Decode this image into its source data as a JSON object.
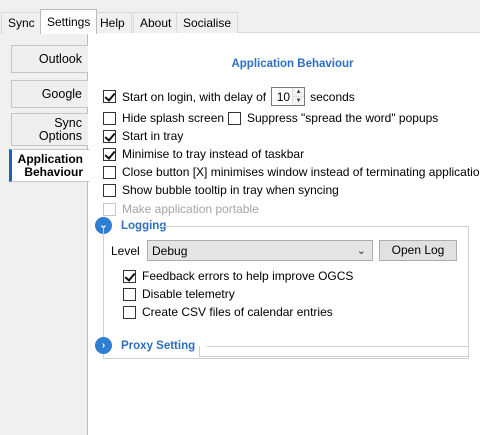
{
  "top_tabs": [
    "Sync",
    "Settings",
    "Help",
    "About",
    "Socialise"
  ],
  "side_tabs": {
    "outlook": "Outlook",
    "google": "Google",
    "sync_options_1": "Sync",
    "sync_options_2": "Options",
    "app_behaviour_1": "Application",
    "app_behaviour_2": "Behaviour"
  },
  "heading": "Application Behaviour",
  "options": {
    "start_on_login_prefix": "Start on login, with delay of",
    "start_on_login_delay": "10",
    "start_on_login_suffix": "seconds",
    "hide_splash": "Hide splash screen",
    "suppress_popups": "Suppress \"spread the word\" popups",
    "start_in_tray": "Start in tray",
    "minimise_to_tray": "Minimise to tray instead of taskbar",
    "close_button": "Close button [X] minimises window instead of terminating application",
    "bubble_tooltip": "Show bubble tooltip in tray when syncing",
    "portable": "Make application portable"
  },
  "logging": {
    "title": "Logging",
    "level_label": "Level",
    "level_value": "Debug",
    "open_log": "Open Log",
    "feedback": "Feedback errors to help improve OGCS",
    "telemetry": "Disable telemetry",
    "csv": "Create CSV files of calendar entries"
  },
  "proxy": {
    "title": "Proxy Setting"
  },
  "state": {
    "start_on_login": true,
    "hide_splash": false,
    "suppress_popups": false,
    "start_in_tray": true,
    "minimise_to_tray": true,
    "close_button": false,
    "bubble_tooltip": false,
    "portable": false,
    "feedback": true,
    "telemetry": false,
    "csv": false
  },
  "icons": {
    "expanded": "chevron-down-icon",
    "collapsed": "chevron-right-icon",
    "spin_up": "▲",
    "spin_down": "▼",
    "dropdown": "⌄",
    "chevron_down": "⌄",
    "chevron_right": "›"
  },
  "colors": {
    "accent": "#2e7ed3",
    "heading": "#2e6ec1",
    "active_tab_border": "#1b64b3"
  }
}
